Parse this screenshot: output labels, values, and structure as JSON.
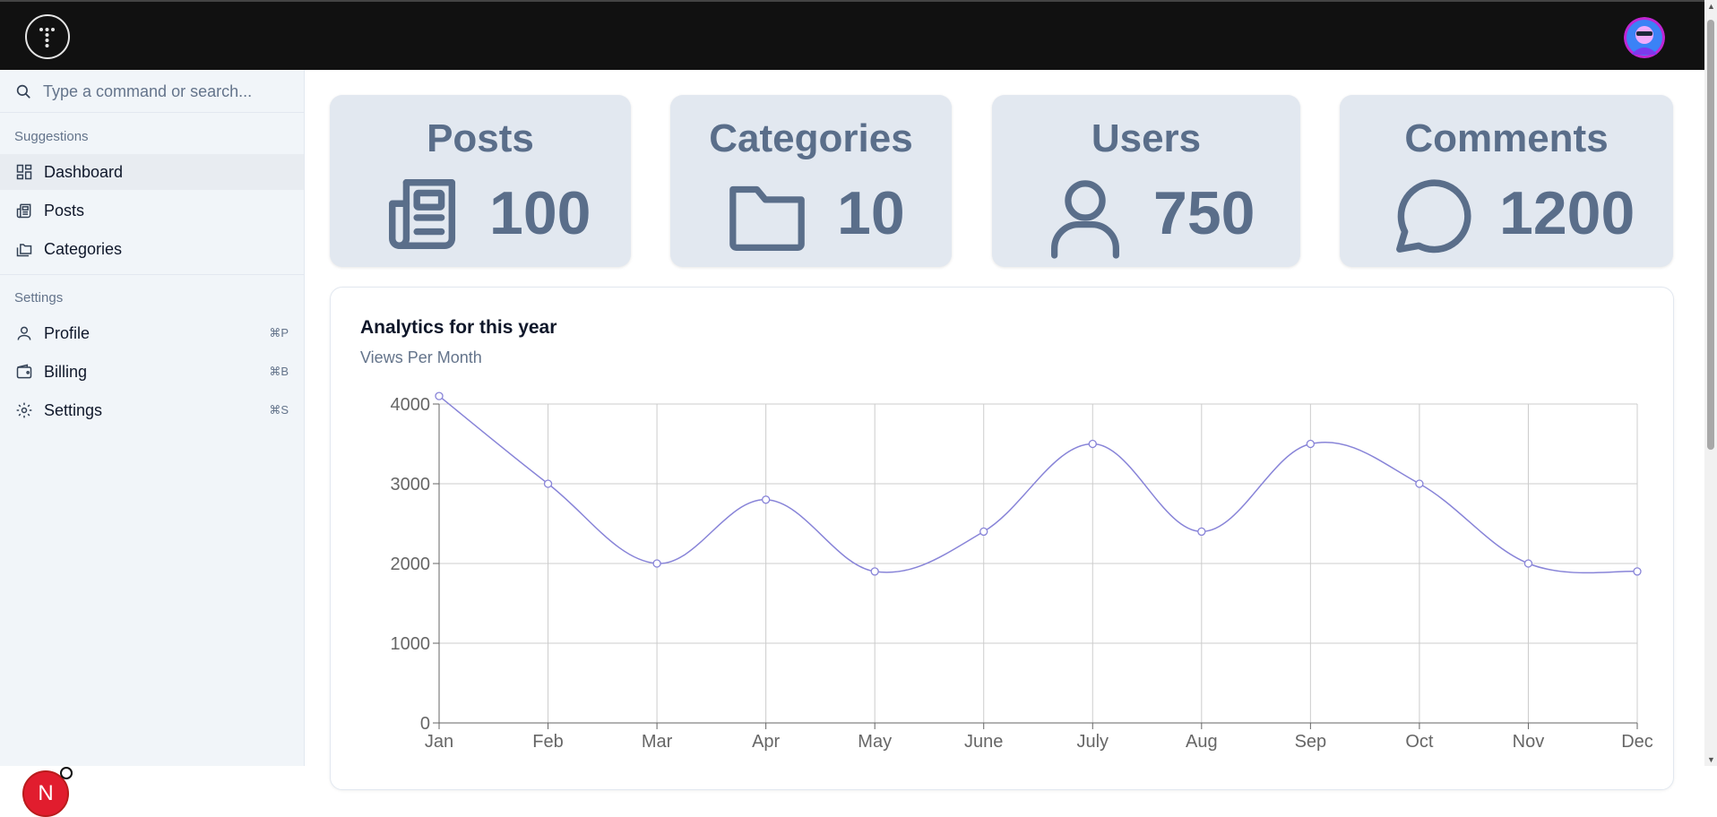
{
  "search": {
    "placeholder": "Type a command or search..."
  },
  "sidebar": {
    "suggestions_heading": "Suggestions",
    "suggestions": [
      {
        "label": "Dashboard",
        "icon": "dashboard-icon"
      },
      {
        "label": "Posts",
        "icon": "newspaper-icon"
      },
      {
        "label": "Categories",
        "icon": "folders-icon"
      }
    ],
    "settings_heading": "Settings",
    "settings": [
      {
        "label": "Profile",
        "icon": "user-icon",
        "shortcut": "⌘P"
      },
      {
        "label": "Billing",
        "icon": "wallet-icon",
        "shortcut": "⌘B"
      },
      {
        "label": "Settings",
        "icon": "gear-icon",
        "shortcut": "⌘S"
      }
    ],
    "badge_letter": "N"
  },
  "stats": [
    {
      "title": "Posts",
      "value": "100",
      "icon": "newspaper-icon"
    },
    {
      "title": "Categories",
      "value": "10",
      "icon": "folder-icon"
    },
    {
      "title": "Users",
      "value": "750",
      "icon": "user-icon"
    },
    {
      "title": "Comments",
      "value": "1200",
      "icon": "comment-icon"
    }
  ],
  "analytics": {
    "title": "Analytics for this year",
    "subtitle": "Views Per Month"
  },
  "chart_data": {
    "type": "line",
    "categories": [
      "Jan",
      "Feb",
      "Mar",
      "Apr",
      "May",
      "June",
      "July",
      "Aug",
      "Sep",
      "Oct",
      "Nov",
      "Dec"
    ],
    "values": [
      4100,
      3000,
      2000,
      2800,
      1900,
      2400,
      3500,
      2400,
      3500,
      3000,
      2000,
      1900
    ],
    "ylim": [
      0,
      4000
    ],
    "yticks": [
      0,
      1000,
      2000,
      3000,
      4000
    ],
    "grid": true,
    "line_color": "#8884d8"
  },
  "colors": {
    "accent": "#5a6e8a",
    "topbar": "#111111",
    "badge": "#e11d2e"
  }
}
